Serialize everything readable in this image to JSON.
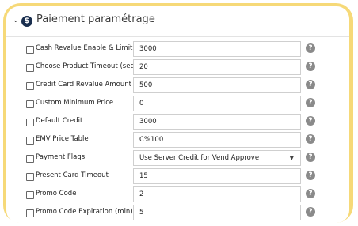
{
  "section": {
    "title": "Paiement paramétrage",
    "icon": "dollar-circle-icon"
  },
  "fields": [
    {
      "label": "Cash Revalue Enable & Limit",
      "value": "3000",
      "type": "text"
    },
    {
      "label": "Choose Product Timeout (sec)",
      "value": "20",
      "type": "text"
    },
    {
      "label": "Credit Card Revalue Amount",
      "value": "500",
      "type": "text"
    },
    {
      "label": "Custom Minimum Price",
      "value": "0",
      "type": "text"
    },
    {
      "label": "Default Credit",
      "value": "3000",
      "type": "text"
    },
    {
      "label": "EMV Price Table",
      "value": "C%100",
      "type": "text"
    },
    {
      "label": "Payment Flags",
      "value": "Use Server Credit for Vend Approve",
      "type": "select"
    },
    {
      "label": "Present Card Timeout",
      "value": "15",
      "type": "text"
    },
    {
      "label": "Promo Code",
      "value": "2",
      "type": "text"
    },
    {
      "label": "Promo Code Expiration (min)",
      "value": "5",
      "type": "text"
    }
  ],
  "help_glyph": "?",
  "colors": {
    "frame": "#f6d978",
    "header_icon": "#1a2f4f",
    "help_icon": "#8a8a8a"
  }
}
